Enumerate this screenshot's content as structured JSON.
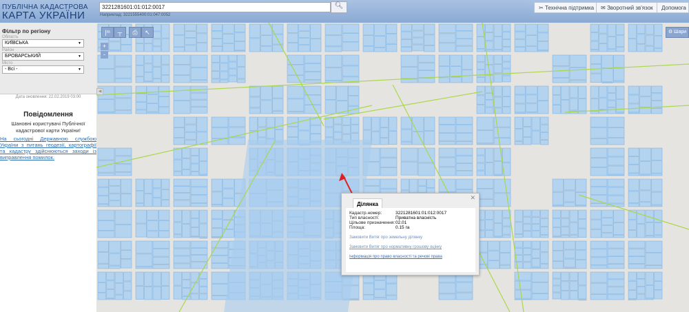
{
  "header": {
    "logo_line1": "ПУБЛІЧНА КАДАСТРОВА",
    "logo_line2": "КАРТА УКРАЇНИ",
    "search_value": "3221281601:01:012:0017",
    "search_hint": "Наприклад: 3221555400:01:047:0052",
    "support": "Технічна підтримка",
    "feedback": "Зворотний зв'язок",
    "help": "Допомога"
  },
  "filter": {
    "title": "Фільтр по регіону",
    "oblast_label": "Область",
    "oblast": "КИЇВСЬКА",
    "rayon_label": "Район",
    "rayon": "БРОВАРСЬКИЙ",
    "city_label": "Місто",
    "city": "- Всі -",
    "date": "Дата оновлення: 22.02.2019 03:00"
  },
  "notice": {
    "title": "Повідомлення",
    "text": "Шановні користувачі Публічної кадастрової карти України!",
    "link": "На сьогодні Державною службою України з питань геодезії, картографії та кадастру здійснюються заходи із виправлення помилок."
  },
  "map": {
    "layers_label": "Шари",
    "zoom_in": "+",
    "zoom_out": "-"
  },
  "popup": {
    "tab": "Ділянка",
    "fields": [
      {
        "k": "Кадастр.номер:",
        "v": "3221281601:01:012:0017"
      },
      {
        "k": "Тип власності:",
        "v": "Приватна власність"
      },
      {
        "k": "Цільове призначення:",
        "v": "02.01"
      },
      {
        "k": "Площа:",
        "v": "0.15 га"
      }
    ],
    "links": [
      "Замовити Витяг про земельну ділянку",
      "Замовити Витяг про нормативну грошову оцінку",
      "Інформація про право власності та речові права"
    ]
  }
}
